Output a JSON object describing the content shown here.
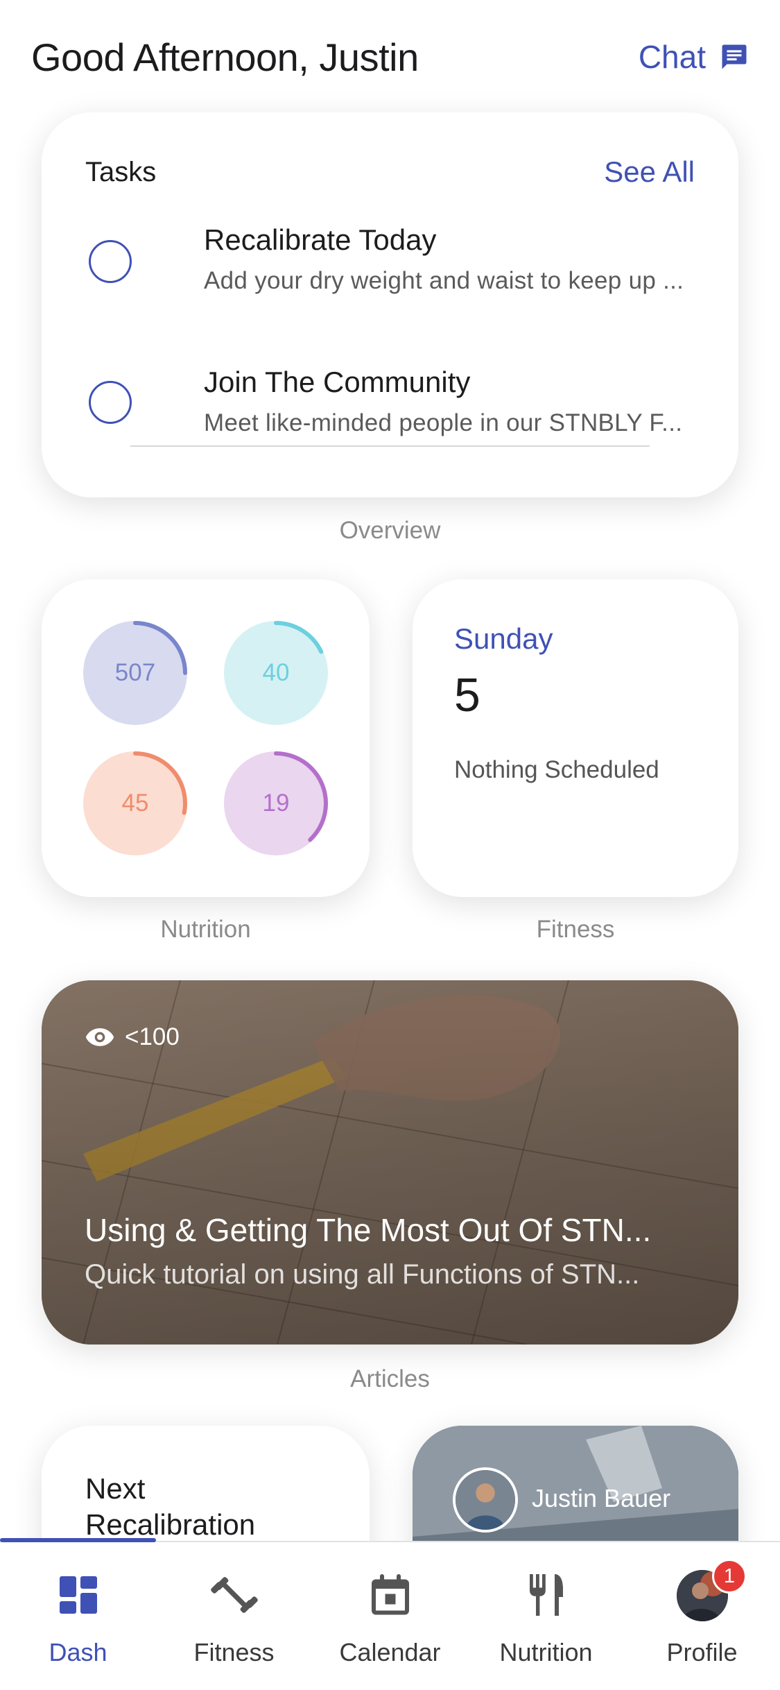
{
  "header": {
    "greeting": "Good Afternoon, Justin",
    "chat_label": "Chat",
    "chat_icon": "chat-icon"
  },
  "tasks": {
    "title": "Tasks",
    "see_all": "See All",
    "items": [
      {
        "title": "Recalibrate Today",
        "subtitle": "Add your dry weight and waist to keep up ..."
      },
      {
        "title": "Join The Community",
        "subtitle": "Meet like-minded people in our STNBLY F..."
      }
    ]
  },
  "sections": {
    "overview": "Overview",
    "nutrition": "Nutrition",
    "fitness": "Fitness",
    "articles": "Articles"
  },
  "nutrition": {
    "rings": [
      {
        "value": "507",
        "progress": 0.25,
        "color": "#7986cb",
        "bg": "#d8dbef"
      },
      {
        "value": "40",
        "progress": 0.18,
        "color": "#6cd0df",
        "bg": "#d5f1f4"
      },
      {
        "value": "45",
        "progress": 0.28,
        "color": "#f08c6c",
        "bg": "#fbddd2"
      },
      {
        "value": "19",
        "progress": 0.38,
        "color": "#b46fcb",
        "bg": "#ead6ef"
      }
    ]
  },
  "fitness": {
    "day": "Sunday",
    "date": "5",
    "status": "Nothing Scheduled"
  },
  "article": {
    "views": "<100",
    "title": "Using & Getting The Most Out Of STN...",
    "subtitle": "Quick tutorial on using all Functions of STN..."
  },
  "recalibration": {
    "title": "Next Recalibration"
  },
  "profile_card": {
    "name": "Justin Bauer"
  },
  "tabbar": {
    "tabs": [
      {
        "label": "Dash",
        "icon": "dashboard-icon",
        "active": true
      },
      {
        "label": "Fitness",
        "icon": "dumbbell-icon"
      },
      {
        "label": "Calendar",
        "icon": "calendar-icon"
      },
      {
        "label": "Nutrition",
        "icon": "fork-knife-icon"
      },
      {
        "label": "Profile",
        "icon": "avatar",
        "badge": "1"
      }
    ]
  },
  "colors": {
    "accent": "#3f51b5",
    "badge": "#e53935"
  }
}
